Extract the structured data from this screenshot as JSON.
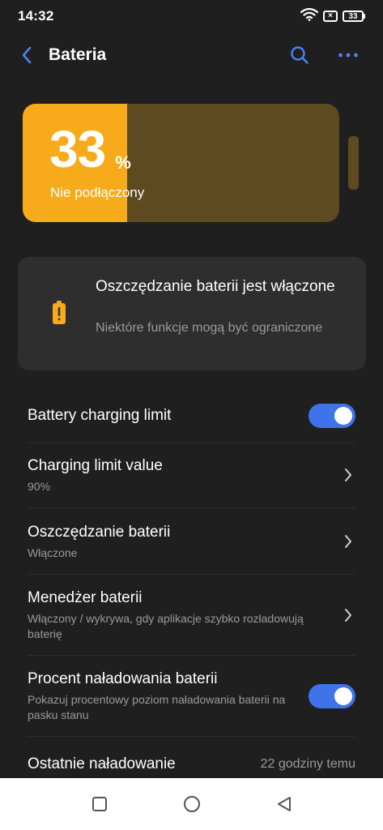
{
  "status_bar": {
    "time": "14:32",
    "sim_label": "×",
    "battery_level": "33"
  },
  "header": {
    "title": "Bateria"
  },
  "battery": {
    "percent_value": "33",
    "percent_sign": "%",
    "charge_fraction": 0.33,
    "plug_status": "Nie podłączony",
    "fill_color": "#f7ab1b",
    "empty_color": "#5e4a20"
  },
  "saver_card": {
    "title": "Oszczędzanie baterii jest włączone",
    "description": "Niektóre funkcje mogą być ograniczone"
  },
  "settings": {
    "charging_limit": {
      "title": "Battery charging limit",
      "enabled": true
    },
    "limit_value": {
      "title": "Charging limit value",
      "value": "90%"
    },
    "battery_saver": {
      "title": "Oszczędzanie baterii",
      "value": "Włączone"
    },
    "battery_manager": {
      "title": "Menedżer baterii",
      "value": "Włączony / wykrywa, gdy aplikacje szybko rozładowują baterię"
    },
    "battery_percent": {
      "title": "Procent naładowania baterii",
      "description": "Pokazuj procentowy poziom naładowania baterii na pasku stanu",
      "enabled": true
    },
    "last_charge": {
      "title": "Ostatnie naładowanie",
      "value": "22 godziny temu"
    }
  },
  "colors": {
    "accent": "#3e73ea",
    "background": "#1f1f1f",
    "card": "#2e2e2e"
  }
}
